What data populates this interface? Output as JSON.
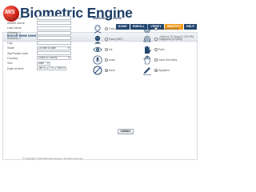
{
  "header": {
    "logo_text": "IWS",
    "brand": "Biometric Engine",
    "nav": [
      "HOME",
      "ENROLL",
      "VERIFY",
      "IDENTIFY",
      "HELP"
    ],
    "active_nav": "IDENTIFY"
  },
  "page": {
    "title": "Enroll New User",
    "userinfo": "New Id: 07-Aug-11 2:51 PM"
  },
  "form": {
    "first_name": "First name",
    "middle_name": "Middle name",
    "last_name": "Last name",
    "address1": "Address 1",
    "address2": "Address 2",
    "city": "City",
    "state": "State",
    "state_value": "Choose a State",
    "zip": "Zip/Postal code",
    "country": "Country",
    "country_value": "Select a Country",
    "sex": "Sex",
    "sex_value": "Male",
    "dob": "Date of birth",
    "dob_month": "Jan",
    "dob_day": "1",
    "dob_year": "1990"
  },
  "biometrics": {
    "title": "Biometrics to Enroll",
    "items": [
      {
        "label": "Face (2D)",
        "icon": "face-2d-icon",
        "selected": false
      },
      {
        "label": "Fingerprint (10/4)",
        "icon": "fingerprint-icon",
        "selected": false
      },
      {
        "label": "Face (NIST)",
        "icon": "face-nist-icon",
        "selected": false
      },
      {
        "label": "Fingerprint (10 print)",
        "icon": "fingerprint-10-icon",
        "selected": false
      },
      {
        "label": "Iris",
        "icon": "iris-icon",
        "selected": false
      },
      {
        "label": "Palm",
        "icon": "palm-icon",
        "selected": false
      },
      {
        "label": "Voice",
        "icon": "voice-icon",
        "selected": false
      },
      {
        "label": "Hand Geometry",
        "icon": "hand-geometry-icon",
        "selected": false
      },
      {
        "label": "None",
        "icon": "none-icon",
        "selected": true
      },
      {
        "label": "Signature",
        "icon": "signature-icon",
        "selected": true
      }
    ]
  },
  "submit_label": "SUBMIT",
  "footer": "© Copyright © 2011 Biometric Engine. All rights reserved."
}
